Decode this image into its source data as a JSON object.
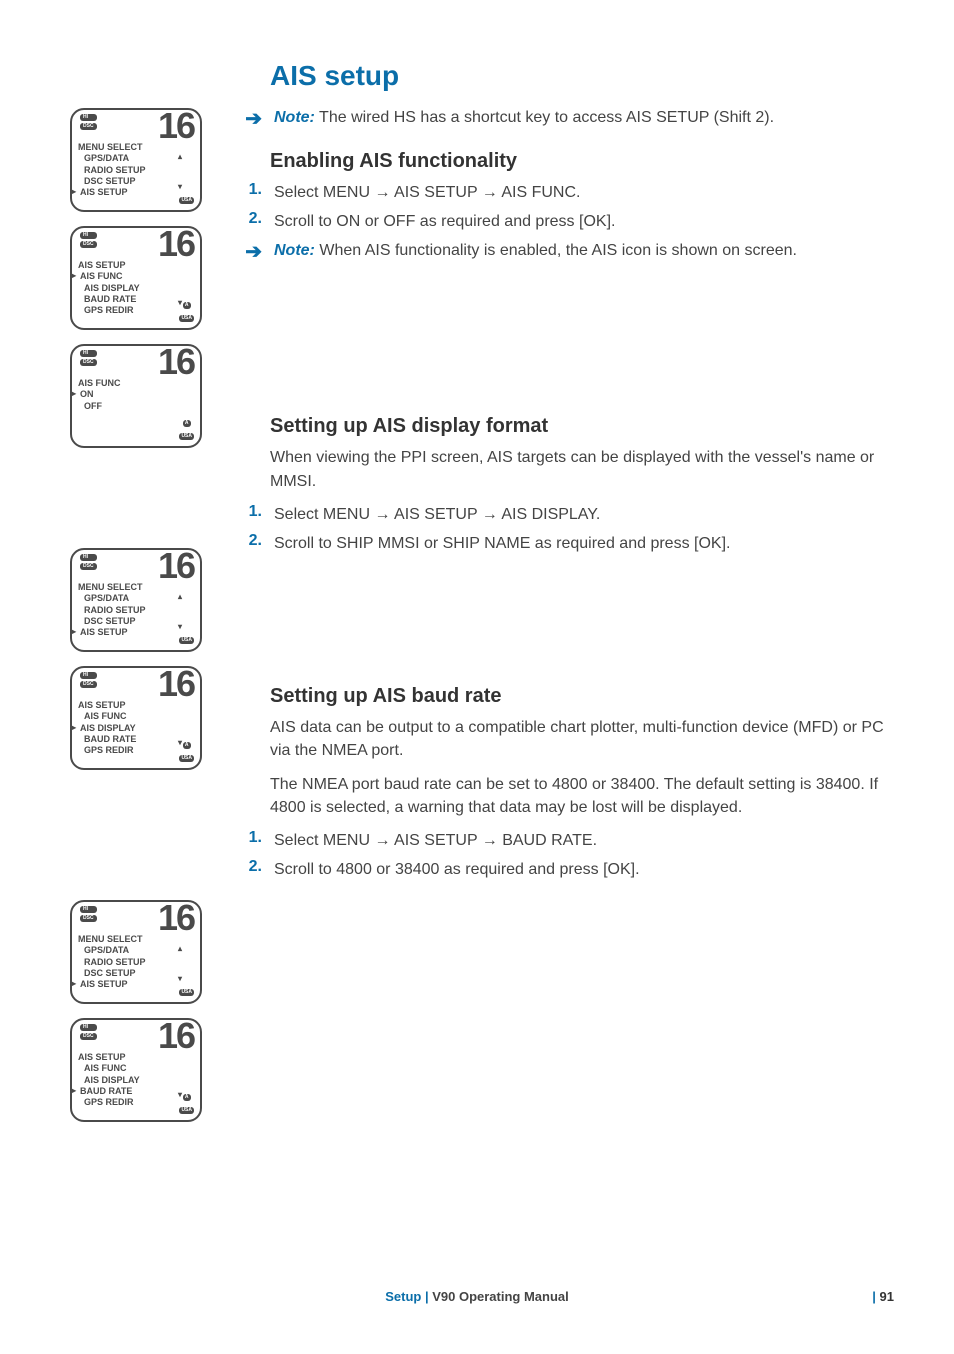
{
  "heading": "AIS setup",
  "note1": {
    "label": "Note:",
    "text": "The wired HS has a shortcut key to access AIS SETUP (Shift 2)."
  },
  "s1": {
    "title": "Enabling AIS functionality",
    "step1": "Select MENU → AIS SETUP → AIS FUNC.",
    "step2": "Scroll to ON or OFF as required and press [OK].",
    "note": {
      "label": "Note:",
      "text": "When AIS functionality is enabled, the AIS icon is shown on screen."
    }
  },
  "s2": {
    "title": "Setting up AIS display format",
    "intro": "When viewing the PPI screen, AIS targets can be displayed with the vessel's name or MMSI.",
    "step1": "Select MENU → AIS SETUP → AIS DISPLAY.",
    "step2": "Scroll to SHIP MMSI or SHIP NAME as required and press [OK]."
  },
  "s3": {
    "title": "Setting up AIS baud rate",
    "p1": "AIS data can be output to a compatible chart plotter, multi-function device (MFD) or PC via the NMEA port.",
    "p2": "The NMEA port baud rate can be set to 4800 or 38400. The default setting is 38400. If 4800 is selected, a warning that data may be lost will be displayed.",
    "step1": "Select MENU → AIS SETUP → BAUD RATE.",
    "step2": "Scroll to 4800 or 38400 as required and press [OK]."
  },
  "channel": "16",
  "badges": {
    "hi": "HI",
    "dsc": "DSC",
    "a": "A",
    "usa": "USA"
  },
  "screens": {
    "menu_select": {
      "title": "MENU SELECT",
      "items": [
        "GPS/DATA",
        "RADIO SETUP",
        "DSC SETUP",
        "AIS SETUP"
      ]
    },
    "ais_setup": {
      "title": "AIS SETUP",
      "items": [
        "AIS FUNC",
        "AIS DISPLAY",
        "BAUD RATE",
        "GPS REDIR"
      ]
    },
    "ais_func": {
      "title": "AIS FUNC",
      "items": [
        "ON",
        "OFF"
      ]
    }
  },
  "footer": {
    "section": "Setup",
    "manual": "V90 Operating Manual",
    "page": "91"
  }
}
